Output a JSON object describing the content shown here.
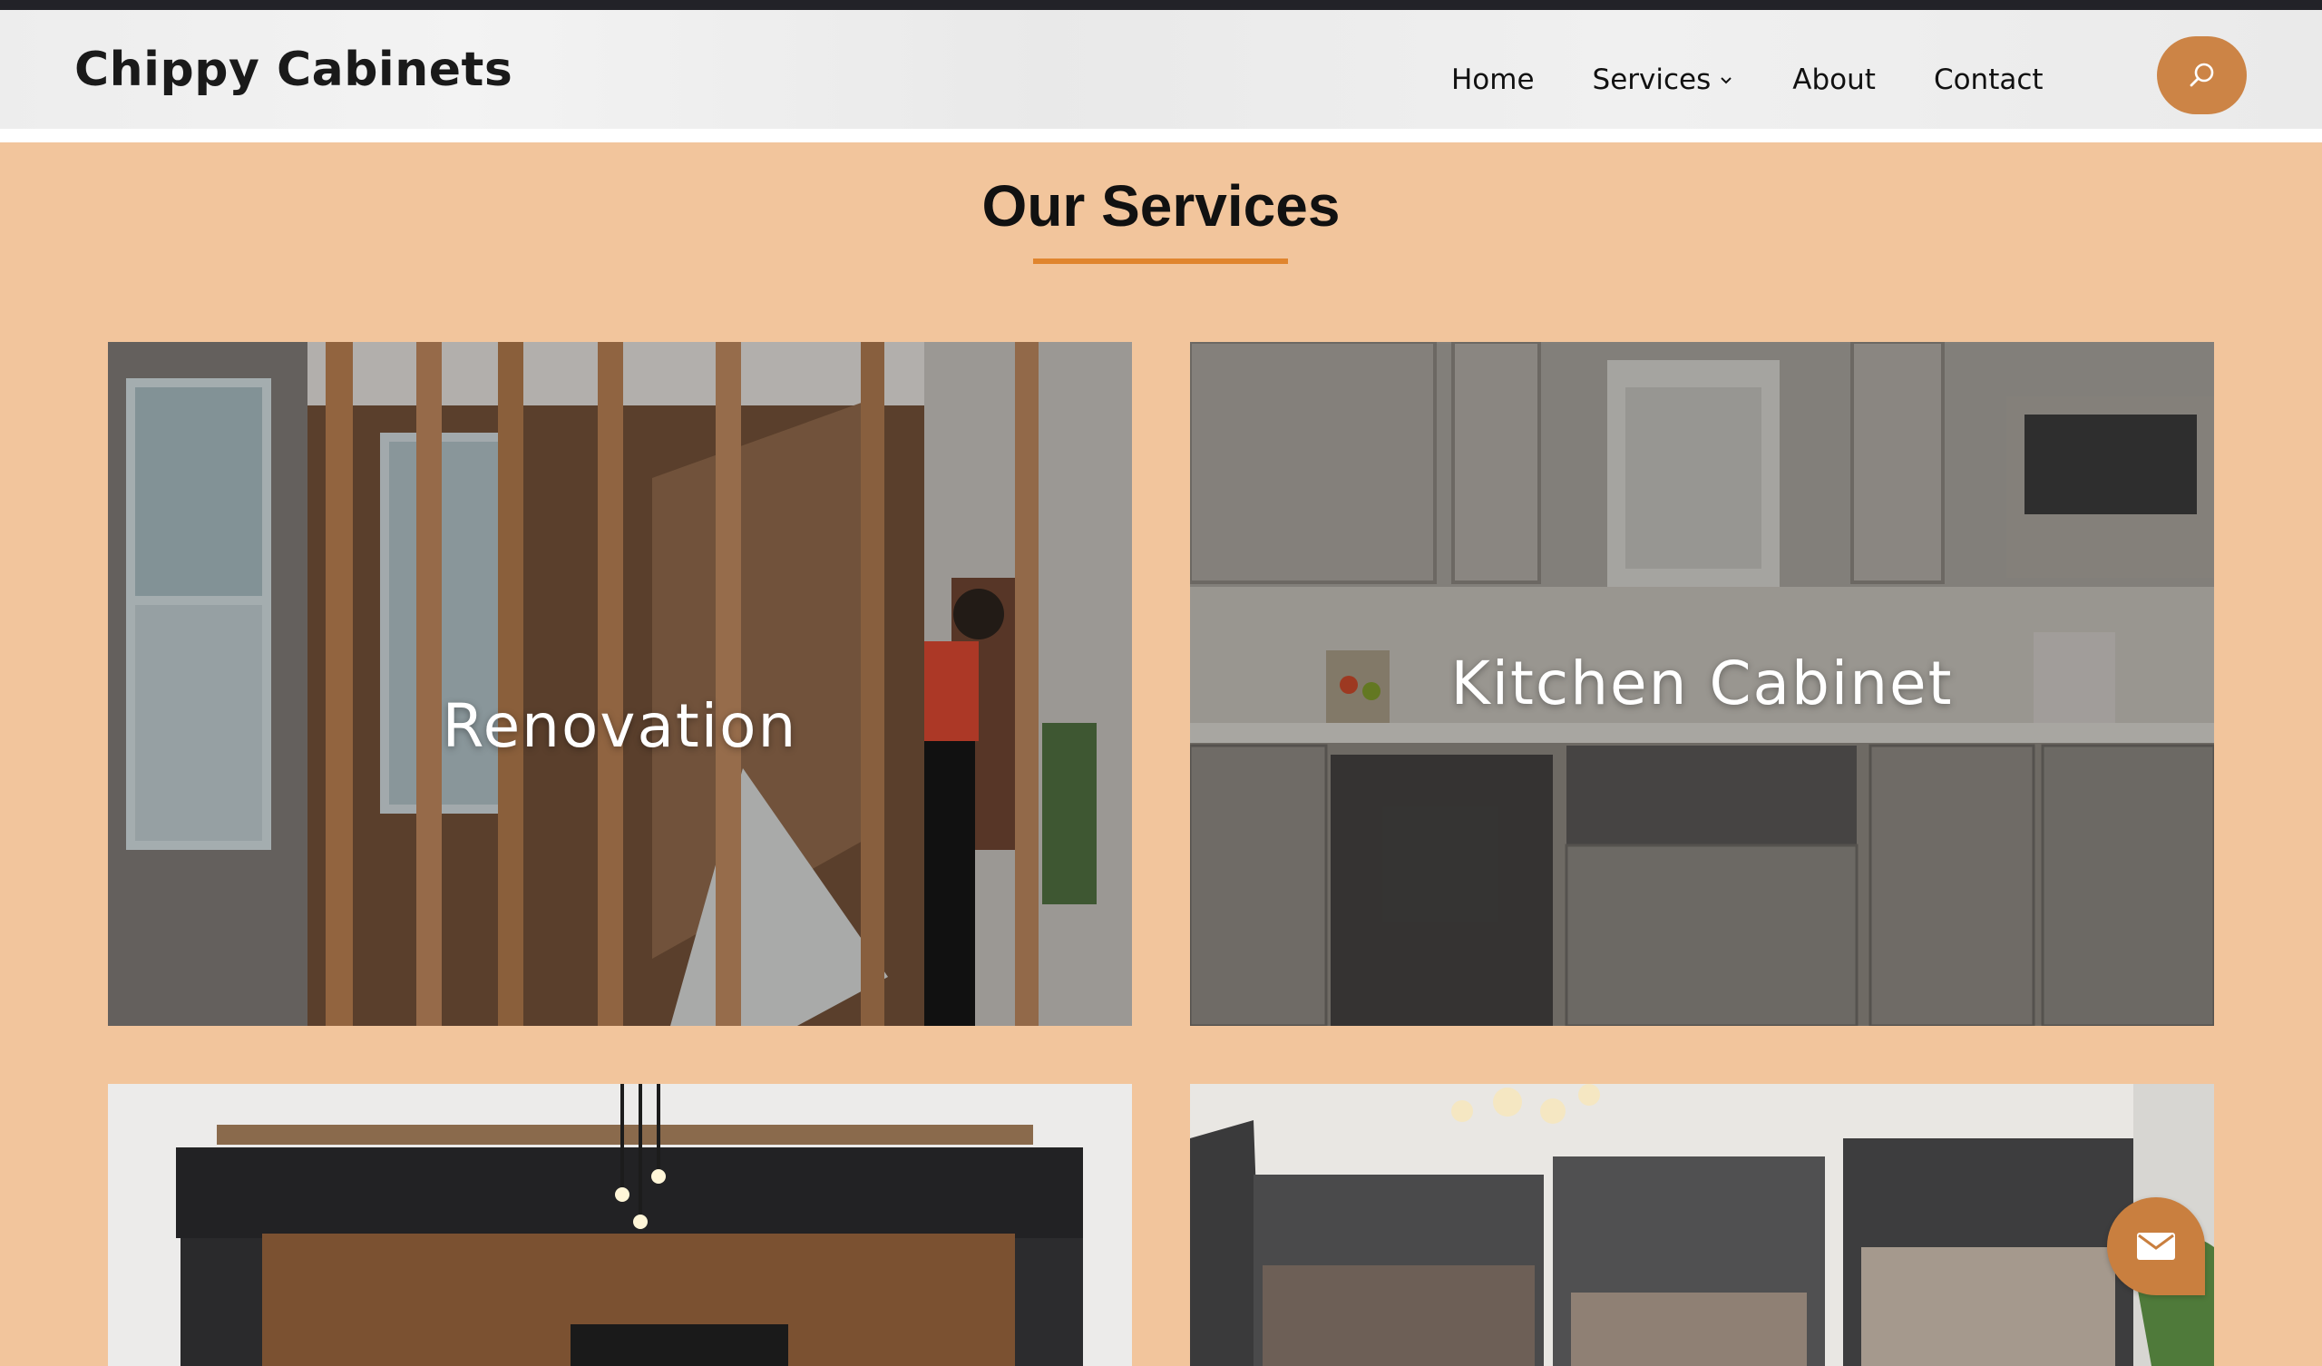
{
  "header": {
    "logo": "Chippy Cabinets",
    "nav": [
      {
        "label": "Home"
      },
      {
        "label": "Services",
        "has_dropdown": true
      },
      {
        "label": "About"
      },
      {
        "label": "Contact"
      }
    ],
    "search_icon": "search-icon"
  },
  "main": {
    "section_title": "Our Services",
    "cards": [
      {
        "label": "Renovation"
      },
      {
        "label": "Kitchen Cabinet"
      },
      {
        "label": ""
      },
      {
        "label": ""
      }
    ]
  },
  "floating": {
    "icon": "mail-icon"
  },
  "colors": {
    "accent": "#cc8446",
    "background": "#f2c59c",
    "underline": "#e0852e",
    "topbar": "#222228"
  }
}
